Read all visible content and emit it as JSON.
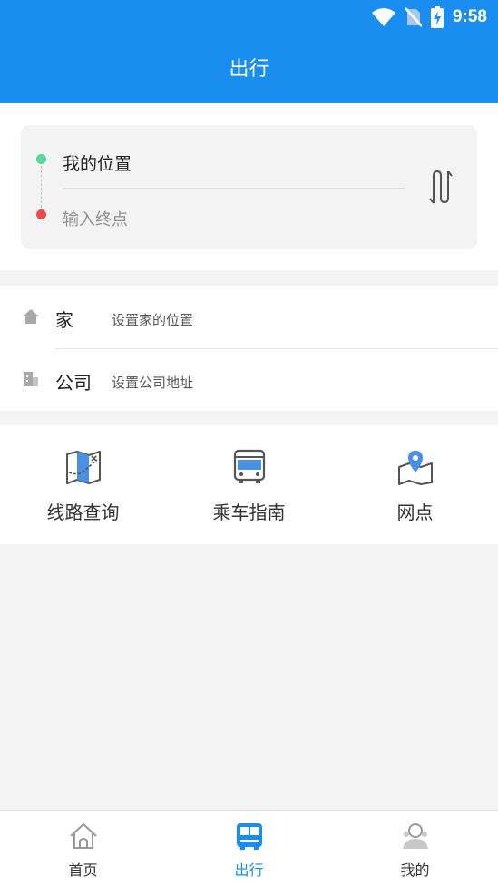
{
  "status_bar": {
    "time": "9:58"
  },
  "header": {
    "title": "出行"
  },
  "route": {
    "from_label": "我的位置",
    "to_placeholder": "输入终点"
  },
  "favorites": [
    {
      "title": "家",
      "subtitle": "设置家的位置"
    },
    {
      "title": "公司",
      "subtitle": "设置公司地址"
    }
  ],
  "services": [
    {
      "label": "线路查询"
    },
    {
      "label": "乘车指南"
    },
    {
      "label": "网点"
    }
  ],
  "bottom_nav": [
    {
      "label": "首页",
      "active": false
    },
    {
      "label": "出行",
      "active": true
    },
    {
      "label": "我的",
      "active": false
    }
  ],
  "colors": {
    "primary": "#1a8ef0",
    "start_dot": "#5bd69c",
    "end_dot": "#ea4a4f"
  }
}
